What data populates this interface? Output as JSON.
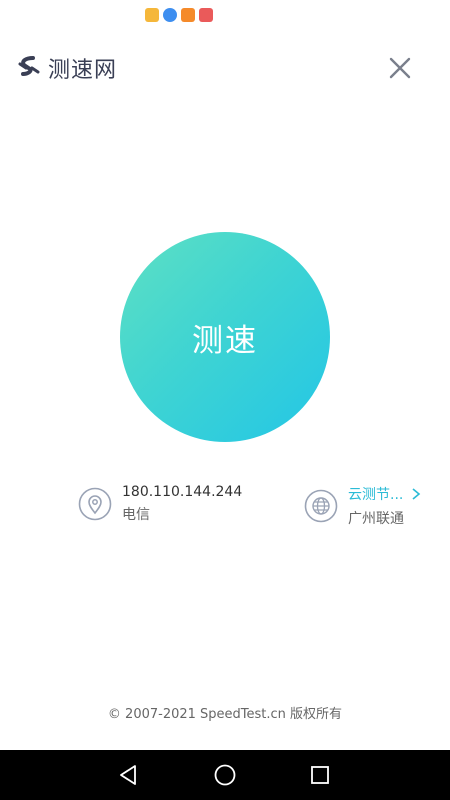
{
  "status_bar": {
    "notification_icons": [
      {
        "name": "calendar-app-icon",
        "color": "#f5b73a"
      },
      {
        "name": "browser-app-icon",
        "color": "#3d8ef0"
      },
      {
        "name": "uc-browser-icon",
        "color": "#f58a2a"
      },
      {
        "name": "reader-app-icon",
        "color": "#ea5a5a"
      }
    ]
  },
  "header": {
    "logo_text": "测速网",
    "close_icon": "close-icon"
  },
  "speed_button": {
    "label": "测速",
    "gradient_start": "#5ee0c3",
    "gradient_end": "#23c6e6"
  },
  "ip_info": {
    "ip": "180.110.144.244",
    "isp": "电信",
    "icon": "location-pin-icon"
  },
  "server_info": {
    "node_label": "云测节...",
    "provider": "广州联通",
    "icon": "globe-icon",
    "accent": "#2bbbd6"
  },
  "footer": {
    "copyright": "© 2007-2021 SpeedTest.cn 版权所有"
  },
  "nav_bar": {
    "back": "back-triangle-icon",
    "home": "home-circle-icon",
    "recents": "recents-square-icon"
  }
}
